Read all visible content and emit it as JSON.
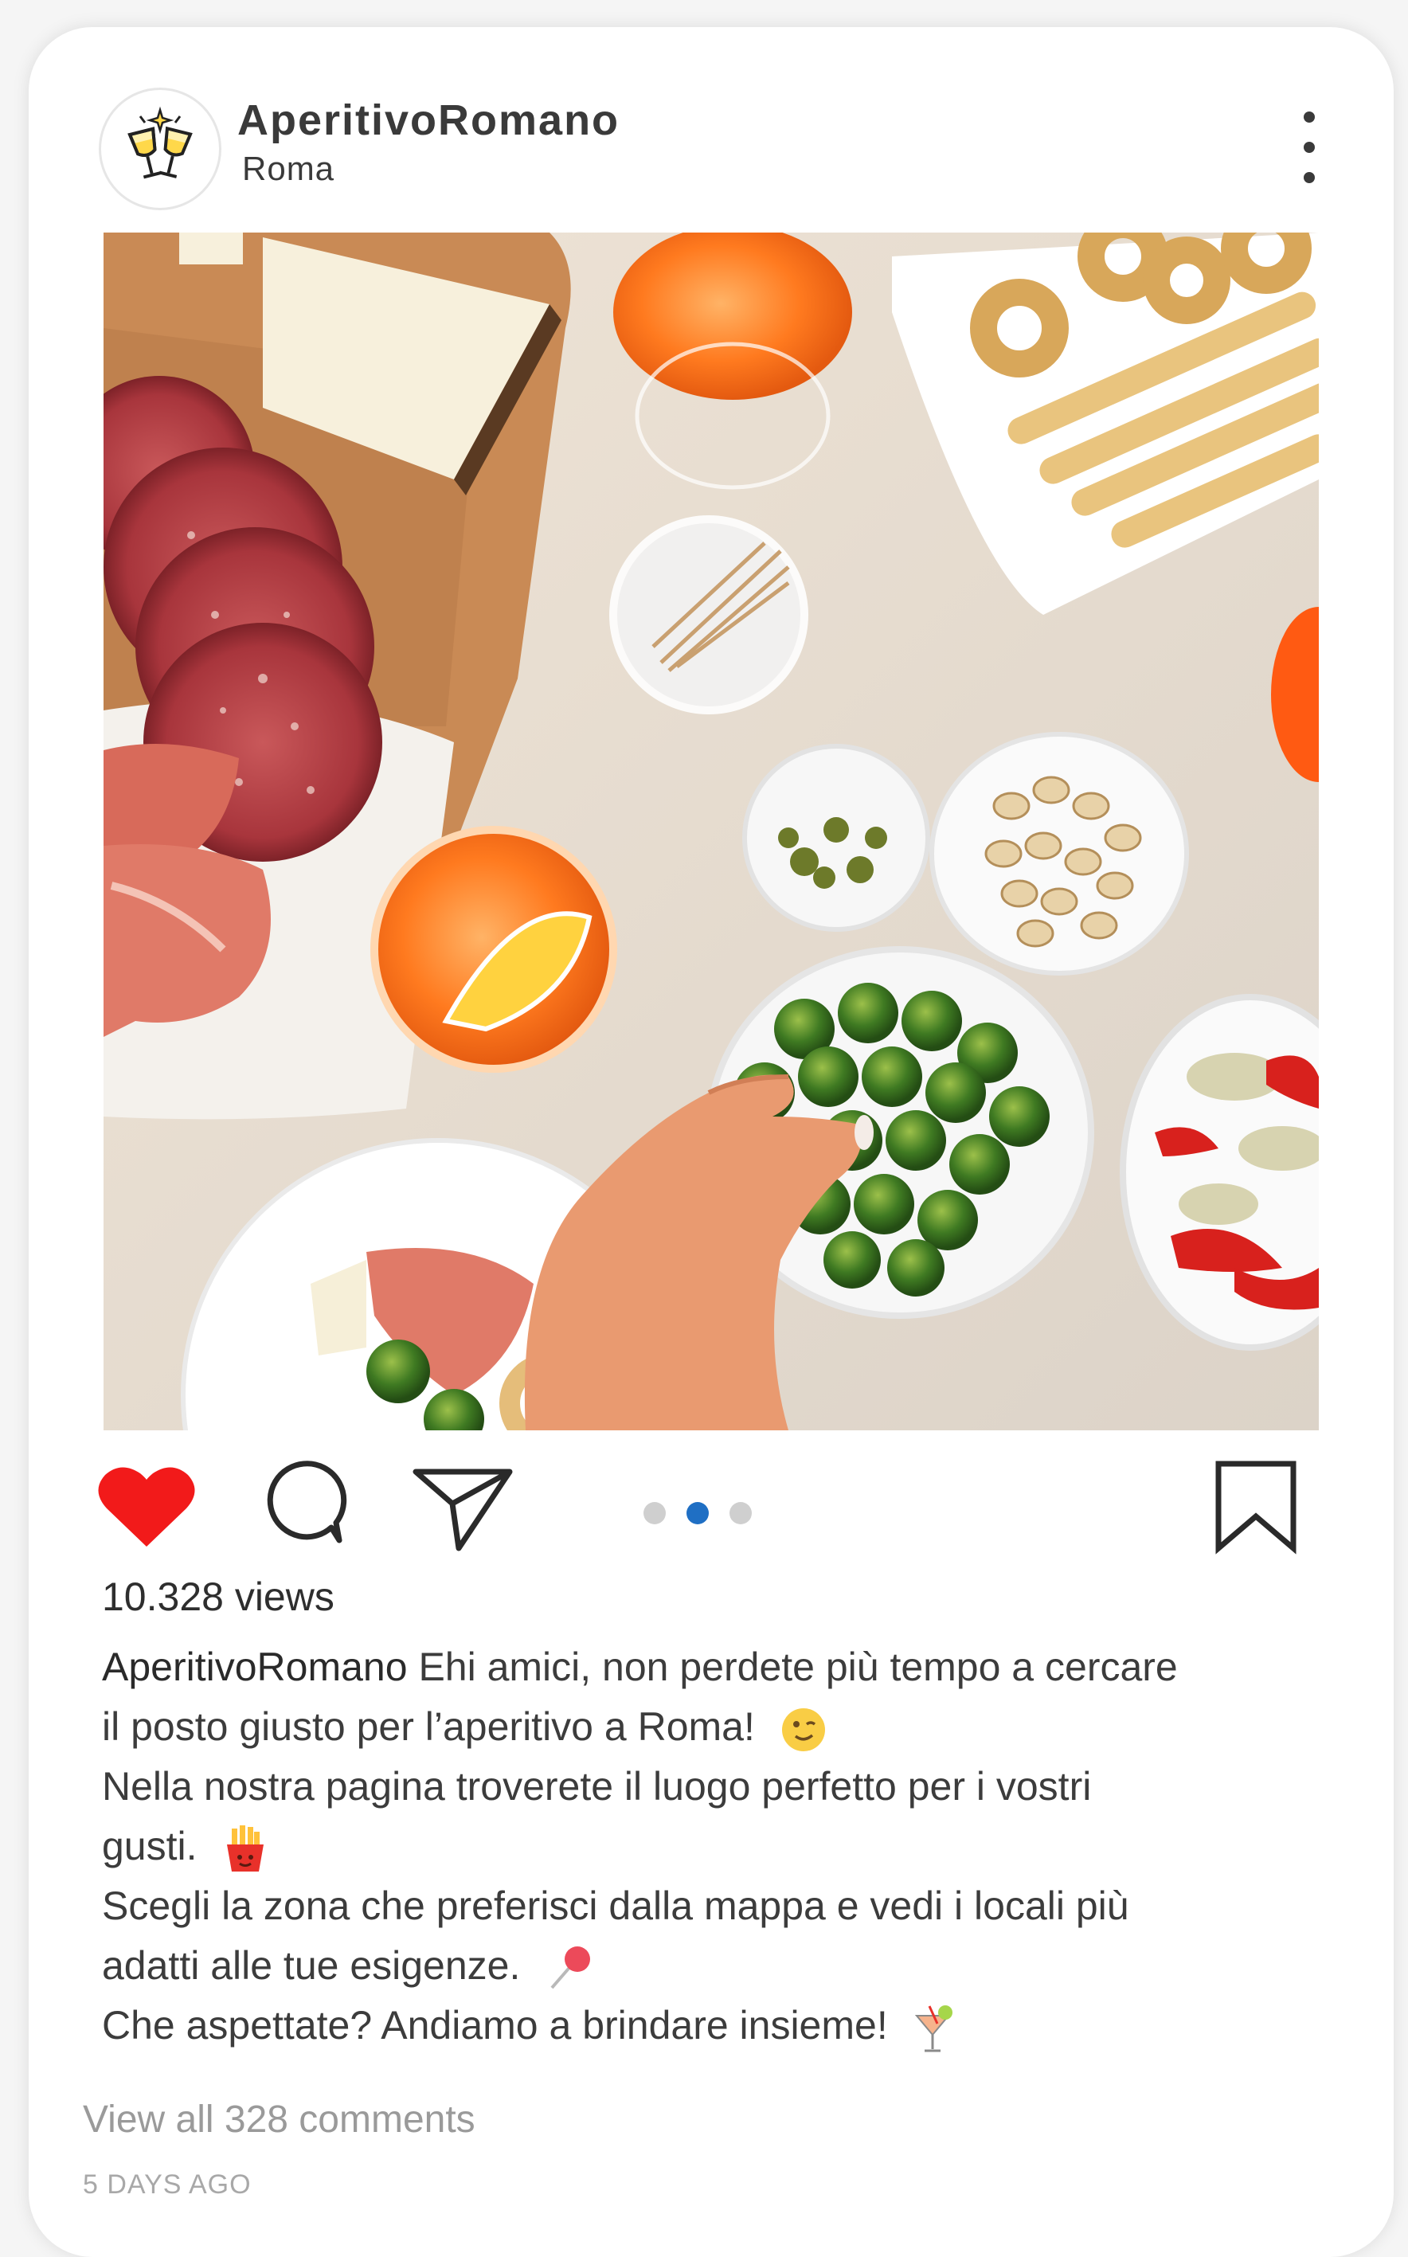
{
  "post": {
    "username": "AperitivoRomano",
    "location": "Roma",
    "views": "10.328 views",
    "caption": {
      "user": "AperitivoRomano",
      "line1": "Ehi amici, non perdete più tempo a cercare",
      "line2": "il posto giusto per l’aperitivo a Roma!",
      "line3": "Nella nostra pagina troverete il luogo perfetto per i vostri",
      "line4": "gusti.",
      "line5": "Scegli la zona che preferisci dalla mappa e vedi i locali più",
      "line6": "adatti alle tue esigenze.",
      "line7": "Che aspettate? Andiamo a brindare insieme!"
    },
    "view_comments": "View all 328 comments",
    "time_ago": "5 DAYS AGO",
    "carousel": {
      "count": 3,
      "active_index": 2
    },
    "liked": true
  },
  "icons": {
    "avatar": "toasting-glasses-icon",
    "more": "more-vertical-icon",
    "like": "heart-icon",
    "comment": "comment-bubble-icon",
    "share": "paper-plane-icon",
    "save": "bookmark-icon"
  },
  "colors": {
    "like": "#f21a1a",
    "carousel_active": "#1f6fc4",
    "carousel_inactive": "#cfcfcf",
    "muted_text": "#9a9a9a"
  }
}
